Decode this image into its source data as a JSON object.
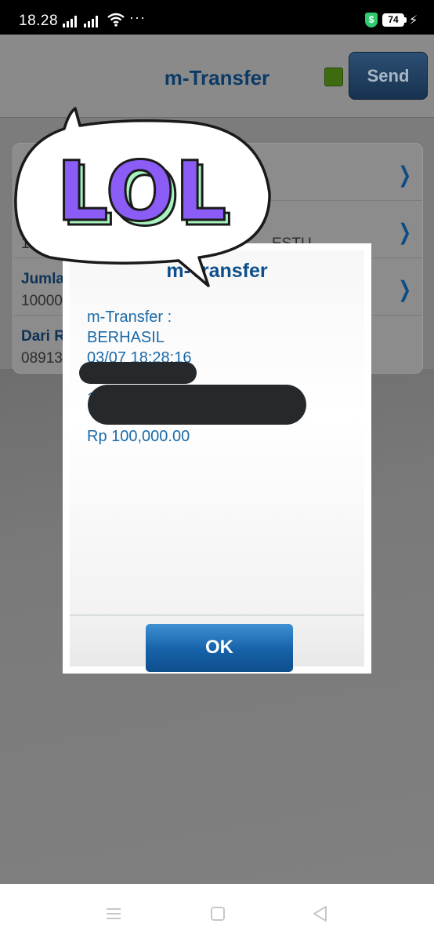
{
  "status_bar": {
    "time": "18.28",
    "more": "···",
    "battery": "74",
    "shield": "$"
  },
  "header": {
    "title": "m-Transfer",
    "send_label": "Send"
  },
  "form": {
    "rows": [
      {
        "label": "",
        "value": "",
        "has_chevron": true
      },
      {
        "label": "",
        "value": "1",
        "extra": "ESTU",
        "has_chevron": true
      },
      {
        "label": "Jumla",
        "value": "10000",
        "has_chevron": true
      },
      {
        "label": "Dari R",
        "value": "08913",
        "has_chevron": false
      }
    ]
  },
  "dialog": {
    "title": "m-Transfer",
    "lines": [
      "m-Transfer :",
      "BERHASIL",
      "03/07 18:28:16",
      "",
      "1",
      "",
      "Rp 100,000.00"
    ],
    "ok_label": "OK"
  },
  "sticker": {
    "text": "LOL",
    "colors": {
      "letters": "#8b5cf6",
      "inner": "#a7f3c0",
      "outline": "#1a1a1a"
    }
  },
  "colors": {
    "accent": "#0c4f8c",
    "message_text": "#1b6aa8",
    "ok_button": "#1561a7"
  },
  "navigation": {
    "icons": [
      "menu-icon",
      "home-square-icon",
      "back-triangle-icon"
    ]
  }
}
